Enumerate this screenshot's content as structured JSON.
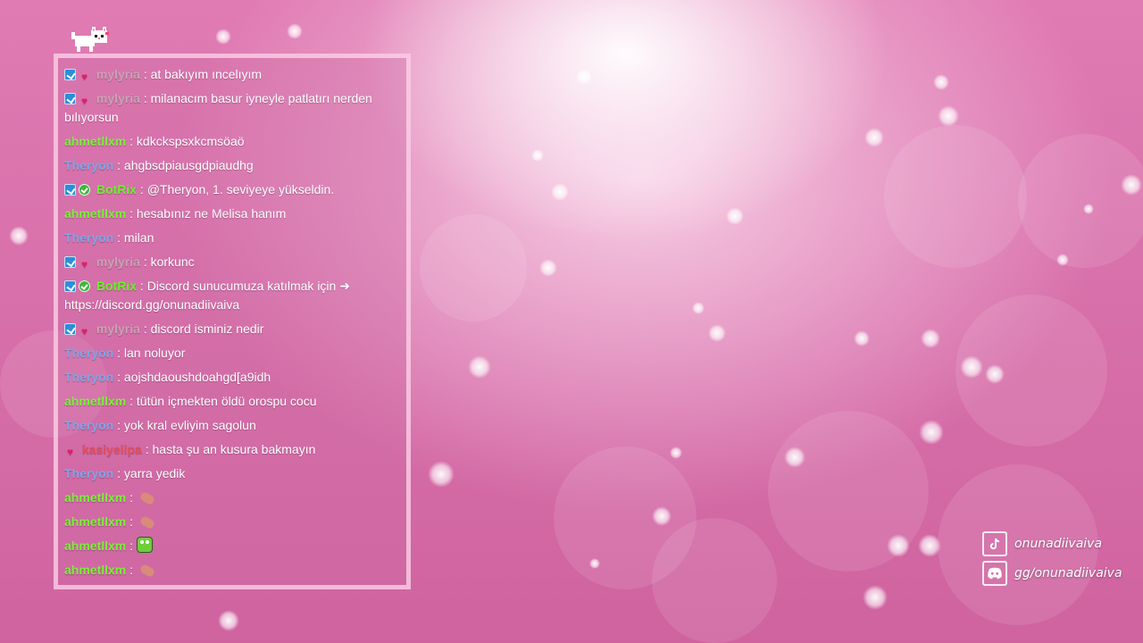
{
  "chat": {
    "messages": [
      {
        "user": "mylyria",
        "text": "at bakıyım ıncelıyım"
      },
      {
        "user": "mylyria",
        "text": "milanacım basur iyneyle patlatırı nerden bılıyorsun"
      },
      {
        "user": "ahmetllxm",
        "text": "kdkckspsxkcmsöaö"
      },
      {
        "user": "Theryon",
        "text": "ahgbsdpiausgdpiaudhg"
      },
      {
        "user": "BotRix",
        "text": "@Theryon, 1. seviyeye yükseldin."
      },
      {
        "user": "ahmetllxm",
        "text": "hesabınız ne Melisa hanım"
      },
      {
        "user": "Theryon",
        "text": "milan"
      },
      {
        "user": "mylyria",
        "text": "korkunc"
      },
      {
        "user": "BotRix",
        "text": "Discord sunucumuza katılmak için ➜ https://discord.gg/onunadiivaiva"
      },
      {
        "user": "mylyria",
        "text": "discord isminiz nedir"
      },
      {
        "user": "Theryon",
        "text": "lan noluyor"
      },
      {
        "user": "Theryon",
        "text": "aojshdaoushdoahgd[a9idh"
      },
      {
        "user": "ahmetllxm",
        "text": "tütün içmekten öldü orospu cocu"
      },
      {
        "user": "Theryon",
        "text": "yok kral evliyim sagolun"
      },
      {
        "user": "kasiyelipa",
        "text": "hasta şu an kusura bakmayın"
      },
      {
        "user": "Theryon",
        "text": "yarra yedik"
      },
      {
        "user": "ahmetllxm",
        "text": ""
      },
      {
        "user": "ahmetllxm",
        "text": ""
      },
      {
        "user": "ahmetllxm",
        "text": ""
      },
      {
        "user": "ahmetllxm",
        "text": ""
      }
    ],
    "separator": ":"
  },
  "socials": {
    "tiktok": "onunadiivaiva",
    "discord": "gg/onunadiivaiva"
  },
  "icons": {
    "mascot": "pixel-cat-icon",
    "tiktok": "tiktok-icon",
    "discord": "discord-icon"
  },
  "colors": {
    "mylyria": "#c9a3b5",
    "ahmetllxm": "#7cf03a",
    "Theryon": "#7fa6e8",
    "BotRix": "#6df02c",
    "kasiyelipa": "#e44d5d"
  }
}
